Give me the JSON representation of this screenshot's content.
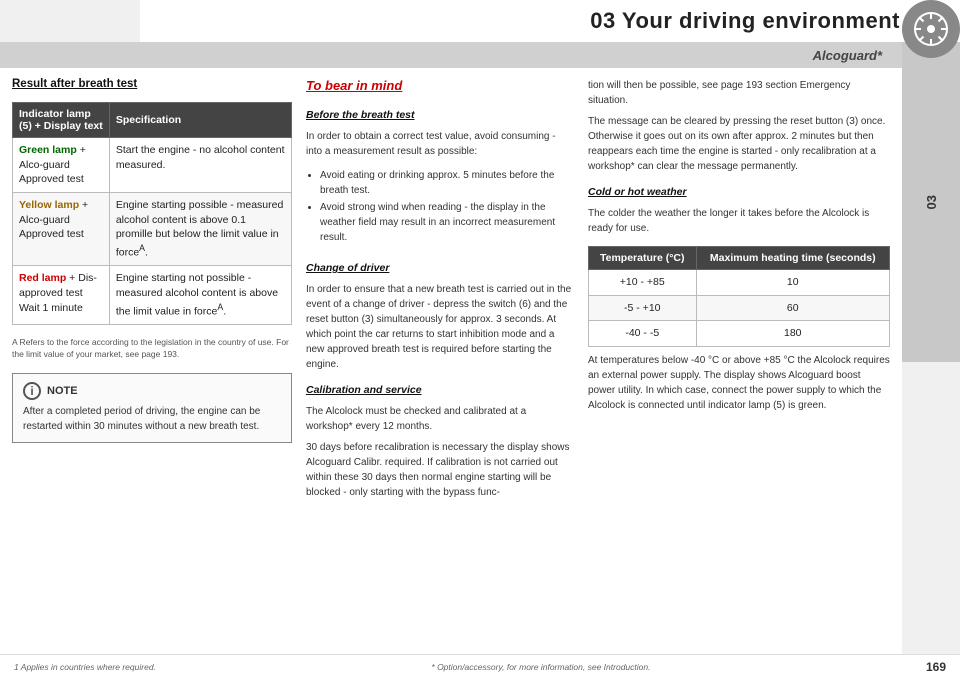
{
  "header": {
    "title": "03 Your driving environment",
    "chapter": "03"
  },
  "alcoguard": {
    "text": "Alcoguard*"
  },
  "left_section": {
    "title": "Result after breath test",
    "table": {
      "col1_header": "Indicator lamp (5) + Display text",
      "col2_header": "Specification",
      "rows": [
        {
          "indicator": "Green lamp + Alco-guard Approved test",
          "indicator_color": "green",
          "spec": "Start the engine - no alcohol content measured."
        },
        {
          "indicator": "Yellow lamp + Alco-guard Approved test",
          "indicator_color": "yellow",
          "spec": "Engine starting possible - measured alcohol content is above 0.1 promille but below the limit value in forceA."
        },
        {
          "indicator": "Red lamp + Dis-approved test Wait 1 minute",
          "indicator_color": "red",
          "spec": "Engine starting not possible - measured alcohol content is above the limit value in forceA."
        }
      ],
      "footnote": "A Refers to the force according to the legislation in the country of use. For the limit value of your market, see page 193."
    },
    "note": {
      "icon": "i",
      "title": "NOTE",
      "text": "After a completed period of driving, the engine can be restarted within 30 minutes without a new breath test."
    }
  },
  "middle_section": {
    "title": "To bear in mind",
    "before_heading": "Before the breath test",
    "before_text": "In order to obtain a correct test value, avoid consuming - into a measurement result as possible:",
    "bullets": [
      "Avoid eating or drinking approx. 5 minutes before the breath test.",
      "Avoid strong wind when reading - the display in the weather field may result in an incorrect measurement result."
    ],
    "change_heading": "Change of driver",
    "change_text": "In order to ensure that a new breath test is carried out in the event of a change of driver - depress the switch (6) and the reset button (3) simultaneously for approx. 3 seconds. At which point the car returns to start inhibition mode and a new approved breath test is required before starting the engine.",
    "calibration_heading": "Calibration and service",
    "calibration_text": "The Alcolock must be checked and calibrated at a workshop* every 12 months.",
    "days_text": "30 days before recalibration is necessary the display shows Alcoguard Calibr. required. If calibration is not carried out within these 30 days then normal engine starting will be blocked - only starting with the bypass func-"
  },
  "right_section": {
    "continue_text": "tion will then be possible, see page 193 section Emergency situation.",
    "clear_text": "The message can be cleared by pressing the reset button (3) once. Otherwise it goes out on its own after approx. 2 minutes but then reappears each time the engine is started - only recalibration at a workshop* can clear the message permanently.",
    "cold_heading": "Cold or hot weather",
    "cold_text": "The colder the weather the longer it takes before the Alcolock is ready for use.",
    "temp_table": {
      "col1_header": "Temperature (°C)",
      "col2_header": "Maximum heating time (seconds)",
      "rows": [
        {
          "temp": "+10 - +85",
          "time": "10"
        },
        {
          "temp": "-5 - +10",
          "time": "60"
        },
        {
          "temp": "-40 - -5",
          "time": "180"
        }
      ]
    },
    "hot_text": "At temperatures below -40 °C or above +85 °C the Alcolock requires an external power supply. The display shows Alcoguard boost power utility. In which case, connect the power supply to which the Alcolock is connected until indicator lamp (5) is green."
  },
  "bottom": {
    "footnote": "1 Applies in countries where required.",
    "option_text": "* Option/accessory, for more information, see Introduction.",
    "page_number": "169"
  }
}
